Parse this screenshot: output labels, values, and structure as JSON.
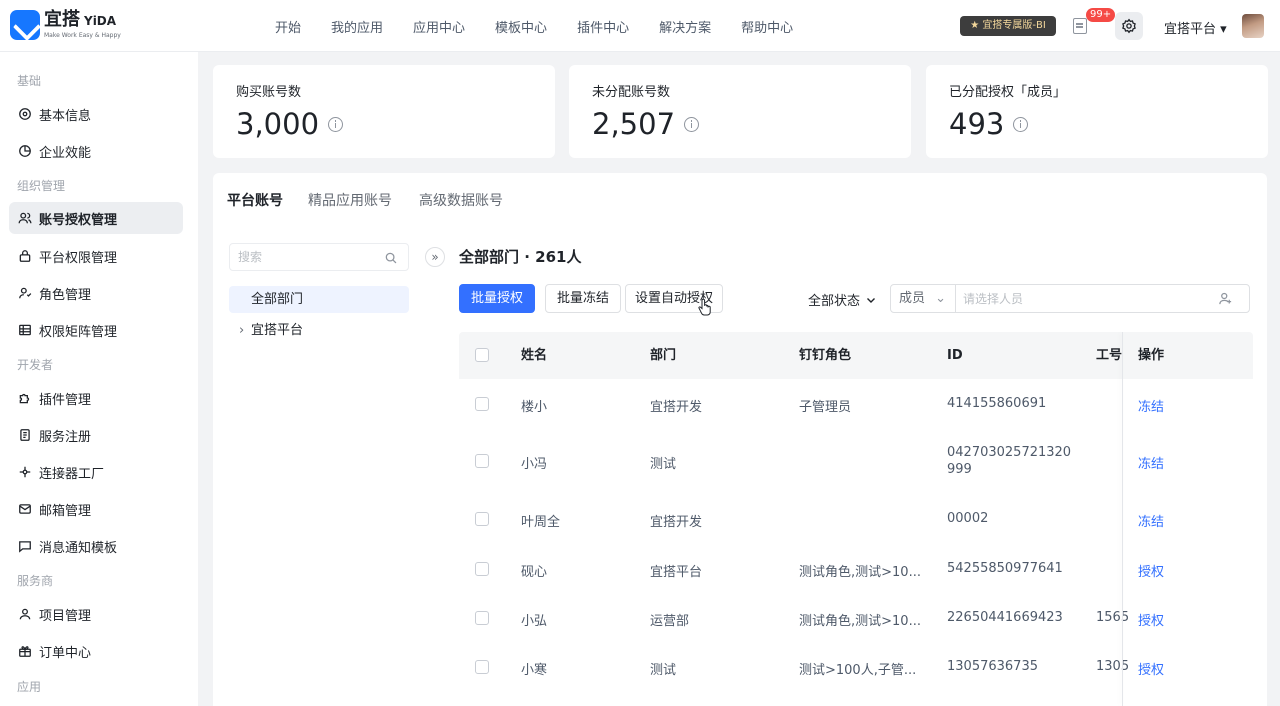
{
  "header": {
    "logo_cn": "宜搭",
    "logo_en": "YiDA",
    "logo_tagline": "Make Work Easy & Happy",
    "nav": [
      "开始",
      "我的应用",
      "应用中心",
      "模板中心",
      "插件中心",
      "解决方案",
      "帮助中心"
    ],
    "bi_badge": "宜搭专属版-BI",
    "notification_count": "99+",
    "platform_menu": "宜搭平台 ▾"
  },
  "sidebar": {
    "groups": [
      "基础",
      "组织管理",
      "开发者",
      "服务商",
      "应用"
    ],
    "items": [
      {
        "label": "基本信息",
        "icon": "gear-icon"
      },
      {
        "label": "企业效能",
        "icon": "chart-pie-icon"
      },
      {
        "label": "账号授权管理",
        "icon": "users-icon"
      },
      {
        "label": "平台权限管理",
        "icon": "lock-icon"
      },
      {
        "label": "角色管理",
        "icon": "user-role-icon"
      },
      {
        "label": "权限矩阵管理",
        "icon": "table-grid-icon"
      },
      {
        "label": "插件管理",
        "icon": "puzzle-icon"
      },
      {
        "label": "服务注册",
        "icon": "document-icon"
      },
      {
        "label": "连接器工厂",
        "icon": "connector-icon"
      },
      {
        "label": "邮箱管理",
        "icon": "mail-icon"
      },
      {
        "label": "消息通知模板",
        "icon": "message-icon"
      },
      {
        "label": "项目管理",
        "icon": "user-icon"
      },
      {
        "label": "订单中心",
        "icon": "gift-icon"
      }
    ],
    "active_index": 2
  },
  "stats": [
    {
      "label": "购买账号数",
      "value": "3,000"
    },
    {
      "label": "未分配账号数",
      "value": "2,507"
    },
    {
      "label": "已分配授权「成员」",
      "value": "493"
    }
  ],
  "tabs": [
    "平台账号",
    "精品应用账号",
    "高级数据账号"
  ],
  "active_tab": 0,
  "search": {
    "placeholder": "搜索"
  },
  "tree": [
    {
      "label": "全部部门"
    },
    {
      "label": "宜搭平台"
    }
  ],
  "dept_title": "全部部门 · 261人",
  "toolbar": {
    "batch_authorize": "批量授权",
    "batch_freeze": "批量冻结",
    "auto_authorize": "设置自动授权",
    "status_filter": "全部状态",
    "member_type": "成员",
    "member_placeholder": "请选择人员"
  },
  "table": {
    "columns": [
      "姓名",
      "部门",
      "钉钉角色",
      "ID",
      "工号",
      "操作"
    ],
    "rows": [
      {
        "name": "楼小",
        "dept": "宜搭开发",
        "role": "子管理员",
        "id": "414155860691",
        "job_no": "",
        "action": "冻结"
      },
      {
        "name": "小冯",
        "dept": "测试",
        "role": "",
        "id": "042703025721320999",
        "job_no": "",
        "action": "冻结"
      },
      {
        "name": "叶周全",
        "dept": "宜搭开发",
        "role": "",
        "id": "00002",
        "job_no": "",
        "action": "冻结"
      },
      {
        "name": "砚心",
        "dept": "宜搭平台",
        "role": "测试角色,测试>10...",
        "id": "54255850977641",
        "job_no": "",
        "action": "授权"
      },
      {
        "name": "小弘",
        "dept": "运营部",
        "role": "测试角色,测试>10...",
        "id": "22650441669423",
        "job_no": "1565",
        "action": "授权"
      },
      {
        "name": "小寒",
        "dept": "测试",
        "role": "测试>100人,子管...",
        "id": "13057636735",
        "job_no": "1305",
        "action": "授权"
      }
    ]
  },
  "colors": {
    "primary": "#3370ff",
    "sidebar_active": "#eceef1",
    "badge": "#f54a45"
  }
}
